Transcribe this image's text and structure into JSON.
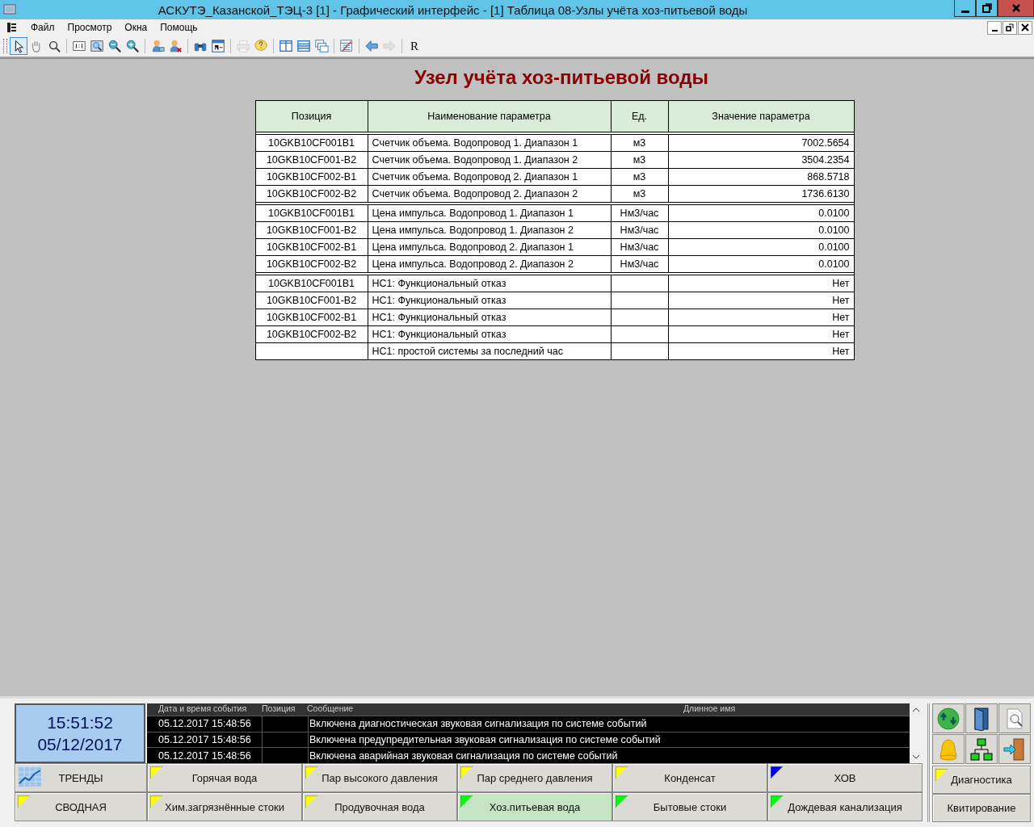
{
  "window": {
    "title": "АСКУТЭ_Казанской_ТЭЦ-3 [1] - Графический интерфейс - [1] Таблица 08-Узлы учёта хоз-питьевой воды"
  },
  "menu": [
    "Файл",
    "Просмотр",
    "Окна",
    "Помощь"
  ],
  "toolbar": {
    "items": [
      {
        "selected": true,
        "disabled": false
      },
      {
        "selected": false,
        "disabled": false
      },
      {
        "selected": false,
        "disabled": false
      },
      {
        "selected": false,
        "disabled": false
      },
      {
        "selected": false,
        "disabled": false
      },
      {
        "selected": false,
        "disabled": false
      },
      {
        "selected": false,
        "disabled": false
      },
      {
        "selected": false,
        "disabled": false
      },
      {
        "selected": false,
        "disabled": false
      },
      {
        "selected": false,
        "disabled": false
      },
      {
        "selected": false,
        "disabled": false
      },
      {
        "selected": false,
        "disabled": true
      },
      {
        "selected": false,
        "disabled": false
      },
      {
        "selected": false,
        "disabled": false
      },
      {
        "selected": false,
        "disabled": false
      },
      {
        "selected": false,
        "disabled": false
      },
      {
        "selected": false,
        "disabled": false
      },
      {
        "selected": false,
        "disabled": false
      },
      {
        "selected": false,
        "disabled": true
      }
    ],
    "text_button": "R"
  },
  "page_title": "Узел учёта хоз-питьевой воды",
  "table": {
    "columns": [
      "Позиция",
      "Наименование параметра",
      "Ед.",
      "Значение параметра"
    ],
    "groups": [
      [
        {
          "position": "10GKB10CF001B1",
          "name": "Счетчик объема. Водопровод 1. Диапазон 1",
          "unit": "м3",
          "value": "7002.5654"
        },
        {
          "position": "10GKB10CF001-B2",
          "name": "Счетчик объема. Водопровод 1. Диапазон 2",
          "unit": "м3",
          "value": "3504.2354"
        },
        {
          "position": "10GKB10CF002-B1",
          "name": "Счетчик объема. Водопровод 2. Диапазон 1",
          "unit": "м3",
          "value": "868.5718"
        },
        {
          "position": "10GKB10CF002-B2",
          "name": "Счетчик объема. Водопровод 2. Диапазон 2",
          "unit": "м3",
          "value": "1736.6130"
        }
      ],
      [
        {
          "position": "10GKB10CF001B1",
          "name": "Цена импульса. Водопровод 1. Диапазон 1",
          "unit": "Нм3/час",
          "value": "0.0100"
        },
        {
          "position": "10GKB10CF001-B2",
          "name": "Цена импульса. Водопровод 1. Диапазон 2",
          "unit": "Нм3/час",
          "value": "0.0100"
        },
        {
          "position": "10GKB10CF002-B1",
          "name": "Цена импульса. Водопровод 2. Диапазон 1",
          "unit": "Нм3/час",
          "value": "0.0100"
        },
        {
          "position": "10GKB10CF002-B2",
          "name": "Цена импульса. Водопровод 2. Диапазон 2",
          "unit": "Нм3/час",
          "value": "0.0100"
        }
      ],
      [
        {
          "position": "10GKB10CF001B1",
          "name": "НС1: Функциональный отказ",
          "value": "Нет"
        },
        {
          "position": "10GKB10CF001-B2",
          "name": "НС1: Функциональный отказ",
          "value": "Нет"
        },
        {
          "position": "10GKB10CF002-B1",
          "name": "НС1: Функциональный отказ",
          "value": "Нет"
        },
        {
          "position": "10GKB10CF002-B2",
          "name": "НС1: Функциональный отказ",
          "value": "Нет"
        },
        {
          "name": "НС1: простой системы за последний час",
          "value": "Нет"
        }
      ]
    ]
  },
  "clock": {
    "time": "15:51:52",
    "date": "05/12/2017"
  },
  "events": {
    "columns": [
      "Дата и время события",
      "Позиция",
      "Сообщение",
      "Длинное имя"
    ],
    "rows": [
      {
        "time": "05.12.2017 15:48:56",
        "message": "Включена диагностическая звуковая сигнализация по системе событий",
        "selected": false
      },
      {
        "time": "05.12.2017 15:48:56",
        "message": "Включена предупредительная звуковая сигнализация по системе событий",
        "selected": false
      },
      {
        "time": "05.12.2017 15:48:56",
        "message": "Включена аварийная звуковая сигнализация по системе событий",
        "selected": false
      }
    ]
  },
  "nav_buttons": [
    [
      {
        "kind": "trend",
        "label": "ТРЕНДЫ",
        "selected": false
      },
      {
        "kind": "flag",
        "label": "Горячая вода",
        "color": "#ffff00",
        "selected": false
      },
      {
        "kind": "flag",
        "label": "Пар высокого давления",
        "color": "#ffff00",
        "selected": false
      },
      {
        "kind": "flag",
        "label": "Пар среднего давления",
        "color": "#ffff00",
        "selected": false
      },
      {
        "kind": "flag",
        "label": "Конденсат",
        "color": "#ffff00",
        "selected": false
      },
      {
        "kind": "flag",
        "label": "ХОВ",
        "color": "#0000ff",
        "selected": false
      }
    ],
    [
      {
        "kind": "flag",
        "label": "СВОДНАЯ",
        "color": "#ffff00",
        "selected": false
      },
      {
        "kind": "flag",
        "label": "Хим.загрязнённые стоки",
        "color": "#ffff00",
        "selected": false
      },
      {
        "kind": "flag",
        "label": "Продувочная вода",
        "color": "#ffff00",
        "selected": false
      },
      {
        "kind": "flag",
        "label": "Хоз.питьевая вода",
        "color": "#00ff00",
        "selected": true
      },
      {
        "kind": "flag",
        "label": "Бытовые стоки",
        "color": "#00ff00",
        "selected": false
      },
      {
        "kind": "flag",
        "label": "Дождевая канализация",
        "color": "#00ff00",
        "selected": false
      }
    ]
  ],
  "side_buttons": [
    {
      "kind": "flag",
      "label": "Диагностика",
      "color": "#ffff00"
    },
    {
      "kind": "plain",
      "label": "Квитирование"
    }
  ]
}
